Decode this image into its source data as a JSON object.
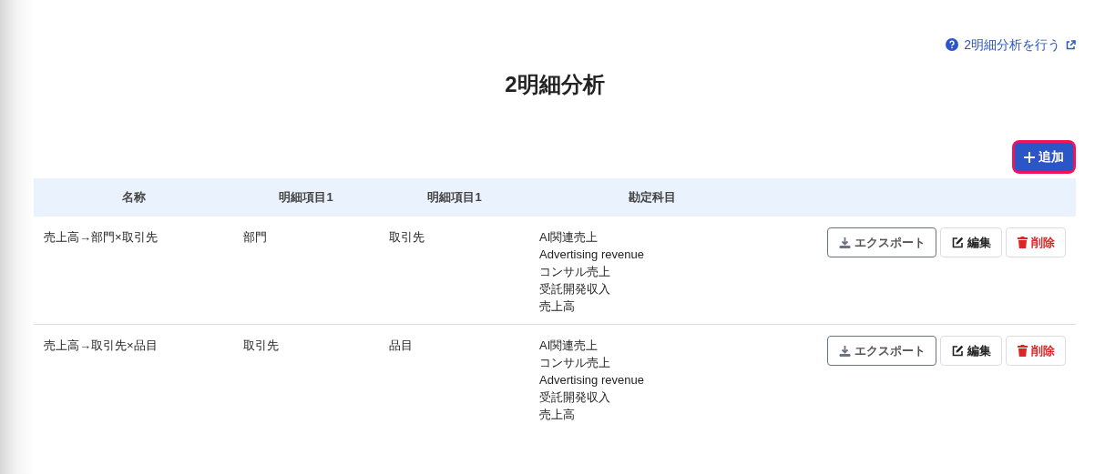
{
  "help_link": {
    "label": "2明細分析を行う"
  },
  "title": "2明細分析",
  "add_button": {
    "label": "追加",
    "highlighted": true
  },
  "table": {
    "columns": [
      "名称",
      "明細項目1",
      "明細項目1",
      "勘定科目"
    ],
    "rows": [
      {
        "name": "売上高→部門×取引先",
        "item_1": "部門",
        "item_2": "取引先",
        "accounts": [
          "AI関連売上",
          "Advertising revenue",
          "コンサル売上",
          "受託開発収入",
          "売上高"
        ],
        "actions": [
          "エクスポート",
          "編集",
          "削除"
        ]
      },
      {
        "name": "売上高→取引先×品目",
        "item_1": "取引先",
        "item_2": "品目",
        "accounts": [
          "AI関連売上",
          "コンサル売上",
          "Advertising revenue",
          "受託開発収入",
          "売上高"
        ],
        "actions": [
          "エクスポート",
          "編集",
          "削除"
        ]
      }
    ]
  }
}
